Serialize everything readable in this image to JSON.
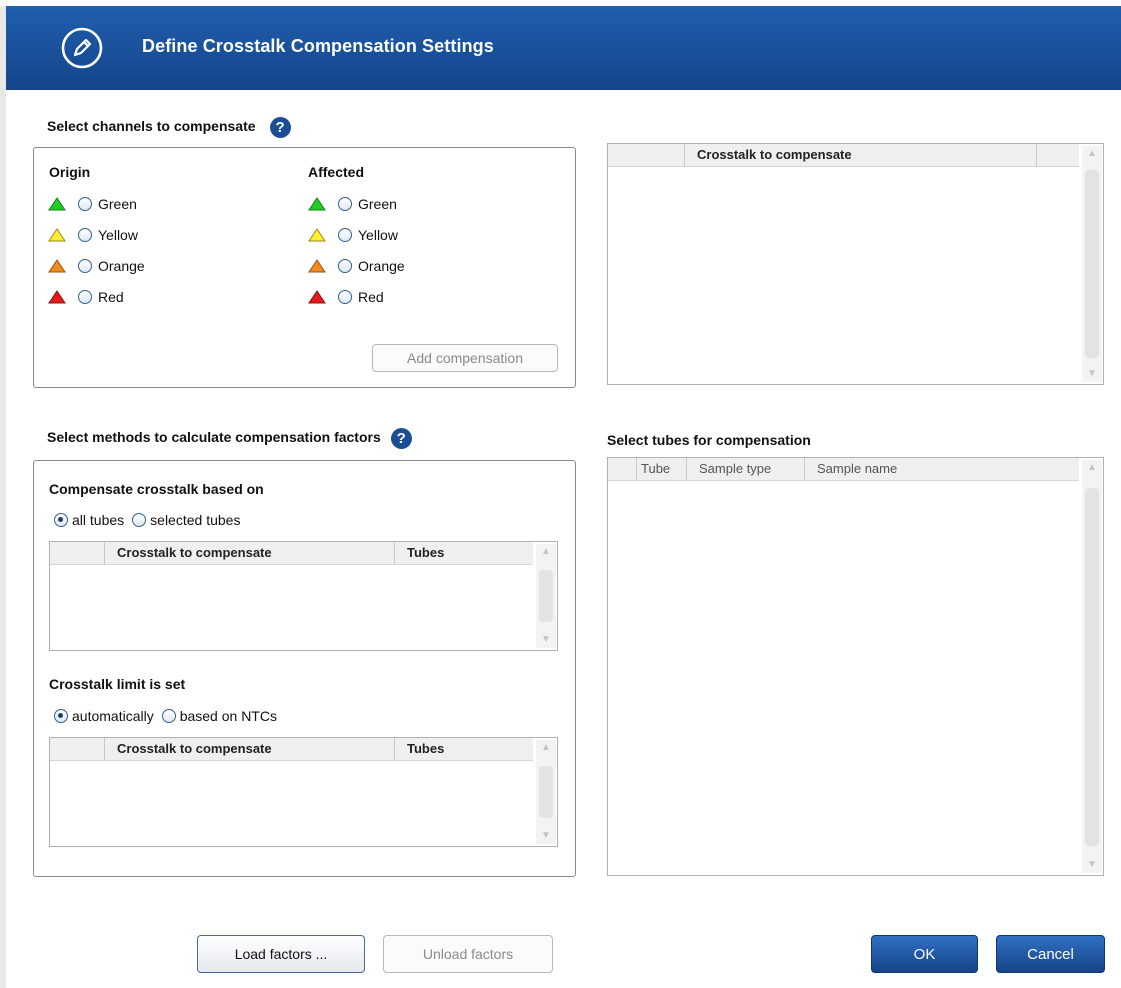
{
  "dialog": {
    "title": "Define Crosstalk Compensation Settings"
  },
  "channels_section": {
    "label": "Select channels to compensate",
    "help": "?",
    "origin_label": "Origin",
    "affected_label": "Affected",
    "channels": [
      {
        "label": "Green",
        "color": "#22cc22"
      },
      {
        "label": "Yellow",
        "color": "#ffee33"
      },
      {
        "label": "Orange",
        "color": "#f08a1c"
      },
      {
        "label": "Red",
        "color": "#e01b1b"
      }
    ],
    "add_button": "Add compensation"
  },
  "crosstalk_grid": {
    "columns": [
      "",
      "Crosstalk to compensate",
      ""
    ]
  },
  "methods_section": {
    "label": "Select methods to calculate compensation factors",
    "help": "?",
    "based_on_label": "Compensate crosstalk based on",
    "based_on_options": [
      "all tubes",
      "selected tubes"
    ],
    "based_on_selected": "all tubes",
    "based_on_grid_columns": [
      "",
      "Crosstalk to compensate",
      "Tubes"
    ],
    "limit_label": "Crosstalk limit is set",
    "limit_options": [
      "automatically",
      "based on NTCs"
    ],
    "limit_selected": "automatically",
    "limit_grid_columns": [
      "",
      "Crosstalk to compensate",
      "Tubes"
    ]
  },
  "tubes_section": {
    "label": "Select tubes for compensation",
    "columns": [
      "",
      "Tube",
      "Sample type",
      "Sample name"
    ]
  },
  "footer": {
    "load_factors": "Load factors ...",
    "unload_factors": "Unload factors",
    "ok": "OK",
    "cancel": "Cancel"
  }
}
